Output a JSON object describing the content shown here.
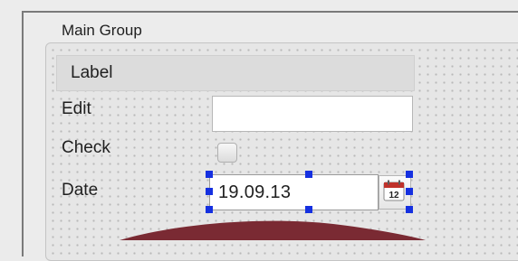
{
  "group": {
    "title": "Main Group"
  },
  "form": {
    "label_text": "Label",
    "edit_label": "Edit",
    "edit_value": "",
    "check_label": "Check",
    "check_checked": false,
    "date_label": "Date",
    "date_value": "19.09.13",
    "calendar_day": "12"
  },
  "colors": {
    "selection_handle": "#1530e0",
    "calendar_header": "#c0322b",
    "overlay": "#7a2a33"
  },
  "icons": {
    "calendar": "calendar-icon"
  }
}
